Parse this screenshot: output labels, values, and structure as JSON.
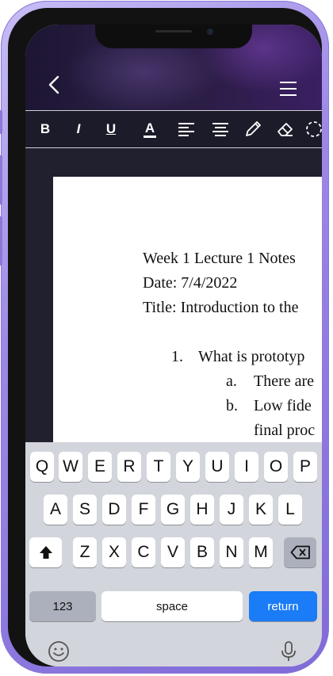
{
  "header": {
    "back_icon": "chevron-left-icon",
    "menu_icon": "hamburger-menu-icon"
  },
  "toolbar": {
    "bold": "B",
    "italic": "I",
    "underline": "U",
    "text_color": "A",
    "align_left_icon": "align-left-icon",
    "align_center_icon": "align-center-icon",
    "pencil_icon": "pencil-icon",
    "eraser_icon": "eraser-icon",
    "lasso_icon": "lasso-select-icon"
  },
  "document": {
    "lines": [
      "Week 1 Lecture 1 Notes",
      "Date: 7/4/2022",
      "Title: Introduction to the",
      "1.",
      "What is prototyp",
      "a.",
      "There are",
      "b.",
      "Low fide",
      "final proc"
    ]
  },
  "keyboard": {
    "row1": [
      "Q",
      "W",
      "E",
      "R",
      "T",
      "Y",
      "U",
      "I",
      "O",
      "P"
    ],
    "row2": [
      "A",
      "S",
      "D",
      "F",
      "G",
      "H",
      "J",
      "K",
      "L"
    ],
    "row3": [
      "Z",
      "X",
      "C",
      "V",
      "B",
      "N",
      "M"
    ],
    "numbers_label": "123",
    "space_label": "space",
    "return_label": "return",
    "shift_icon": "shift-icon",
    "delete_icon": "backspace-icon",
    "emoji_icon": "emoji-icon",
    "mic_icon": "microphone-icon"
  },
  "colors": {
    "return_key": "#1a7cf6",
    "toolbar_bg": "#1c1b29",
    "doc_bg": "#21202e"
  }
}
